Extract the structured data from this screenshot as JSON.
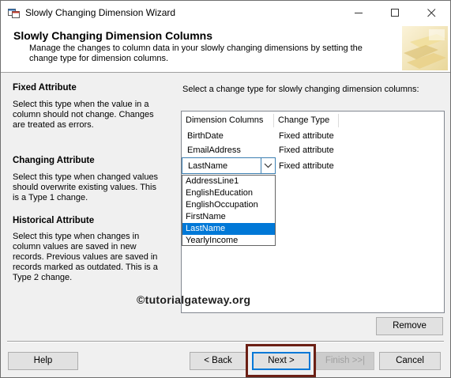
{
  "window": {
    "title": "Slowly Changing Dimension Wizard"
  },
  "header": {
    "title": "Slowly Changing Dimension Columns",
    "description": "Manage the changes to column data in your slowly changing dimensions by setting the change type for dimension columns."
  },
  "left_pane": {
    "fixed": {
      "heading": "Fixed Attribute",
      "body": "Select this type when the value in a column should not change. Changes are treated as errors."
    },
    "changing": {
      "heading": "Changing Attribute",
      "body": "Select this type when changed values should overwrite existing values. This is a Type 1 change."
    },
    "historical": {
      "heading": "Historical Attribute",
      "body": "Select this type when changes in column values are saved in new records. Previous values are saved in records marked as outdated. This is a Type 2 change."
    }
  },
  "grid": {
    "instruction": "Select a change type for slowly changing dimension columns:",
    "columns": [
      "Dimension Columns",
      "Change Type"
    ],
    "rows": [
      {
        "column": "BirthDate",
        "change_type": "Fixed attribute"
      },
      {
        "column": "EmailAddress",
        "change_type": "Fixed attribute"
      },
      {
        "column": "LastName",
        "change_type": "Fixed attribute"
      }
    ],
    "combo_value": "LastName",
    "dropdown_options": [
      "AddressLine1",
      "EnglishEducation",
      "EnglishOccupation",
      "FirstName",
      "LastName",
      "YearlyIncome"
    ],
    "dropdown_selected": "LastName"
  },
  "watermark": "©tutorialgateway.org",
  "buttons": {
    "remove": "Remove",
    "help": "Help",
    "back": "< Back",
    "next": "Next >",
    "finish": "Finish >>|",
    "cancel": "Cancel"
  },
  "colors": {
    "selection": "#0078d7",
    "callout_box": "#6b1f14"
  }
}
